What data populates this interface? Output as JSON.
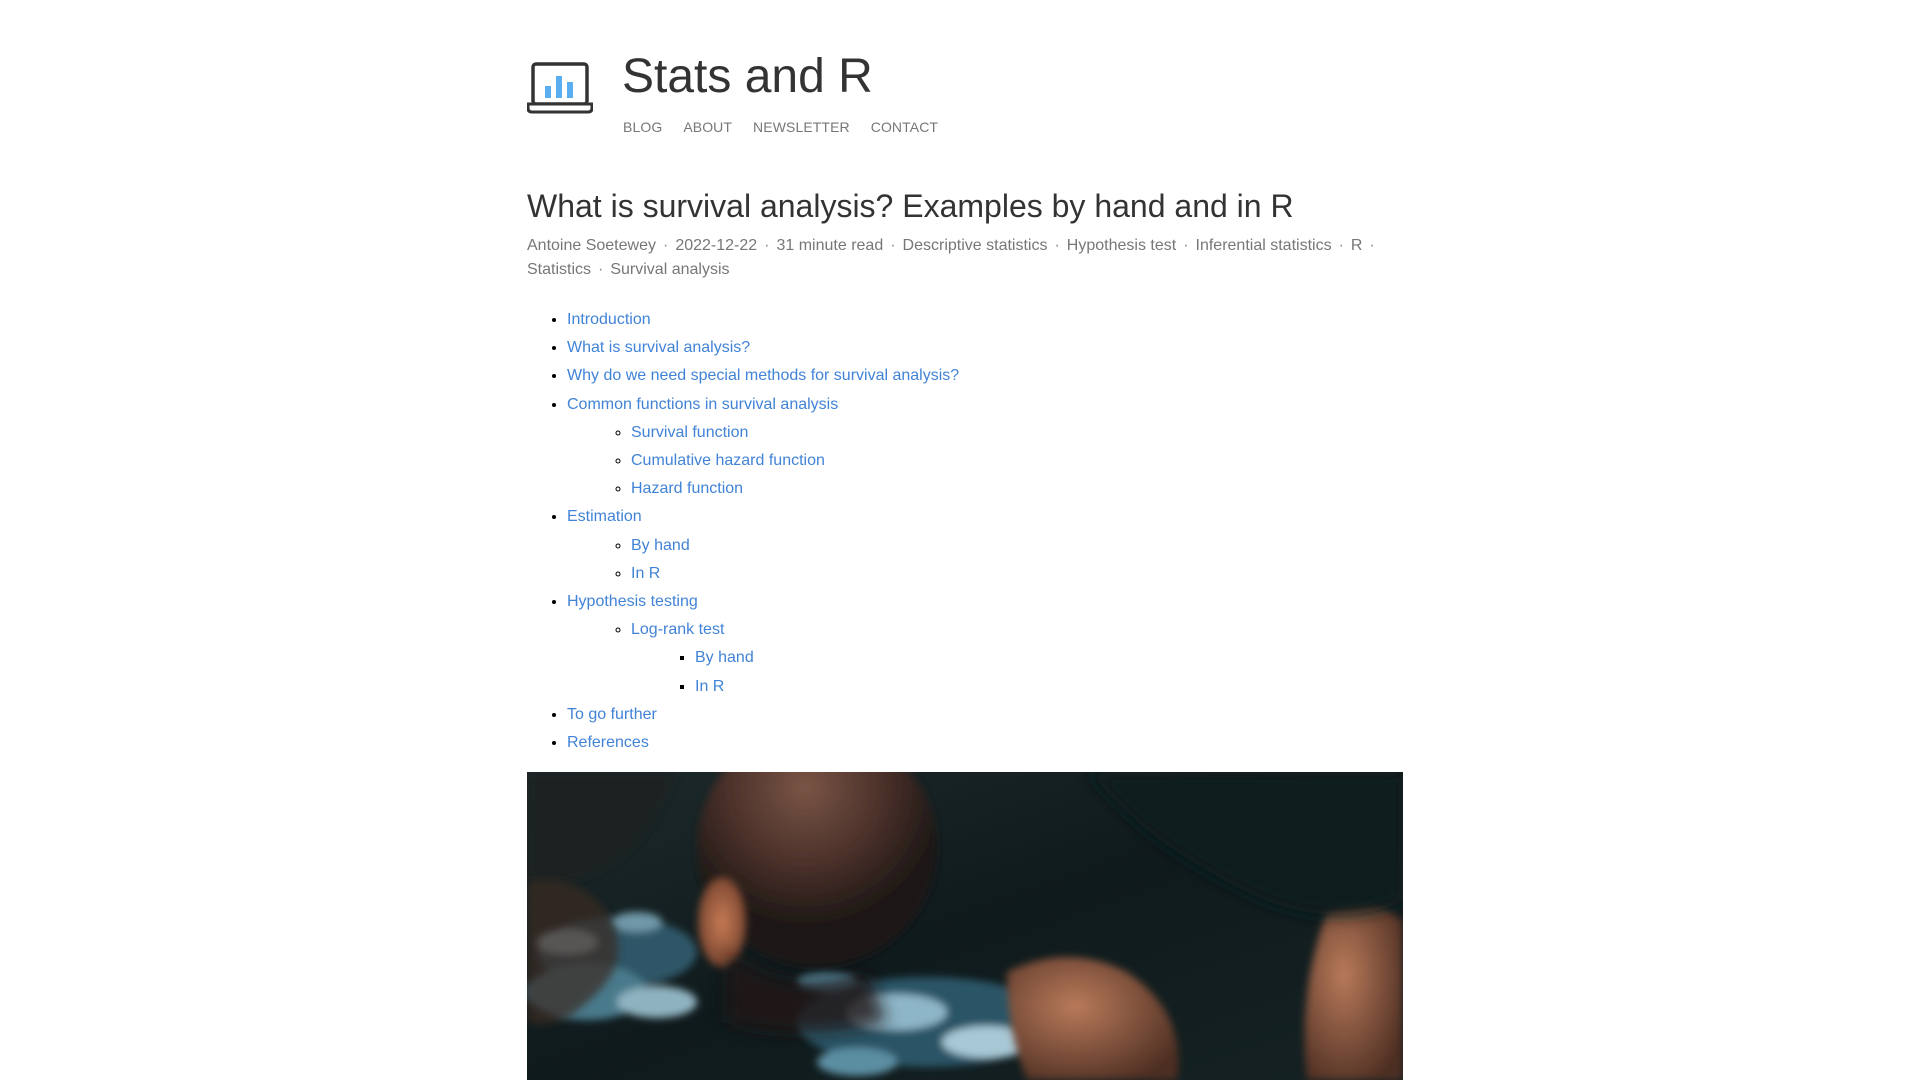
{
  "site": {
    "title": "Stats and R",
    "nav": [
      "BLOG",
      "ABOUT",
      "NEWSLETTER",
      "CONTACT"
    ],
    "logo_icon": "laptop-bar-chart-icon",
    "logo_bar_color": "#5aaef0",
    "logo_frame_color": "#333333"
  },
  "post": {
    "title": "What is survival analysis? Examples by hand and in R",
    "author": "Antoine Soetewey",
    "date": "2022-12-22",
    "read_time": "31 minute read",
    "tags": [
      "Descriptive statistics",
      "Hypothesis test",
      "Inferential statistics",
      "R",
      "Statistics",
      "Survival analysis"
    ]
  },
  "toc": {
    "introduction": "Introduction",
    "what_is": "What is survival analysis?",
    "why_special": "Why do we need special methods for survival analysis?",
    "common_functions": "Common functions in survival analysis",
    "survival_function": "Survival function",
    "cumulative_hazard": "Cumulative hazard function",
    "hazard_function": "Hazard function",
    "estimation": "Estimation",
    "estimation_by_hand": "By hand",
    "estimation_in_r": "In R",
    "hypothesis_testing": "Hypothesis testing",
    "log_rank_test": "Log-rank test",
    "log_rank_by_hand": "By hand",
    "log_rank_in_r": "In R",
    "to_go_further": "To go further",
    "references": "References"
  },
  "colors": {
    "link": "#4183d7",
    "text": "#333333",
    "meta": "#777777"
  }
}
